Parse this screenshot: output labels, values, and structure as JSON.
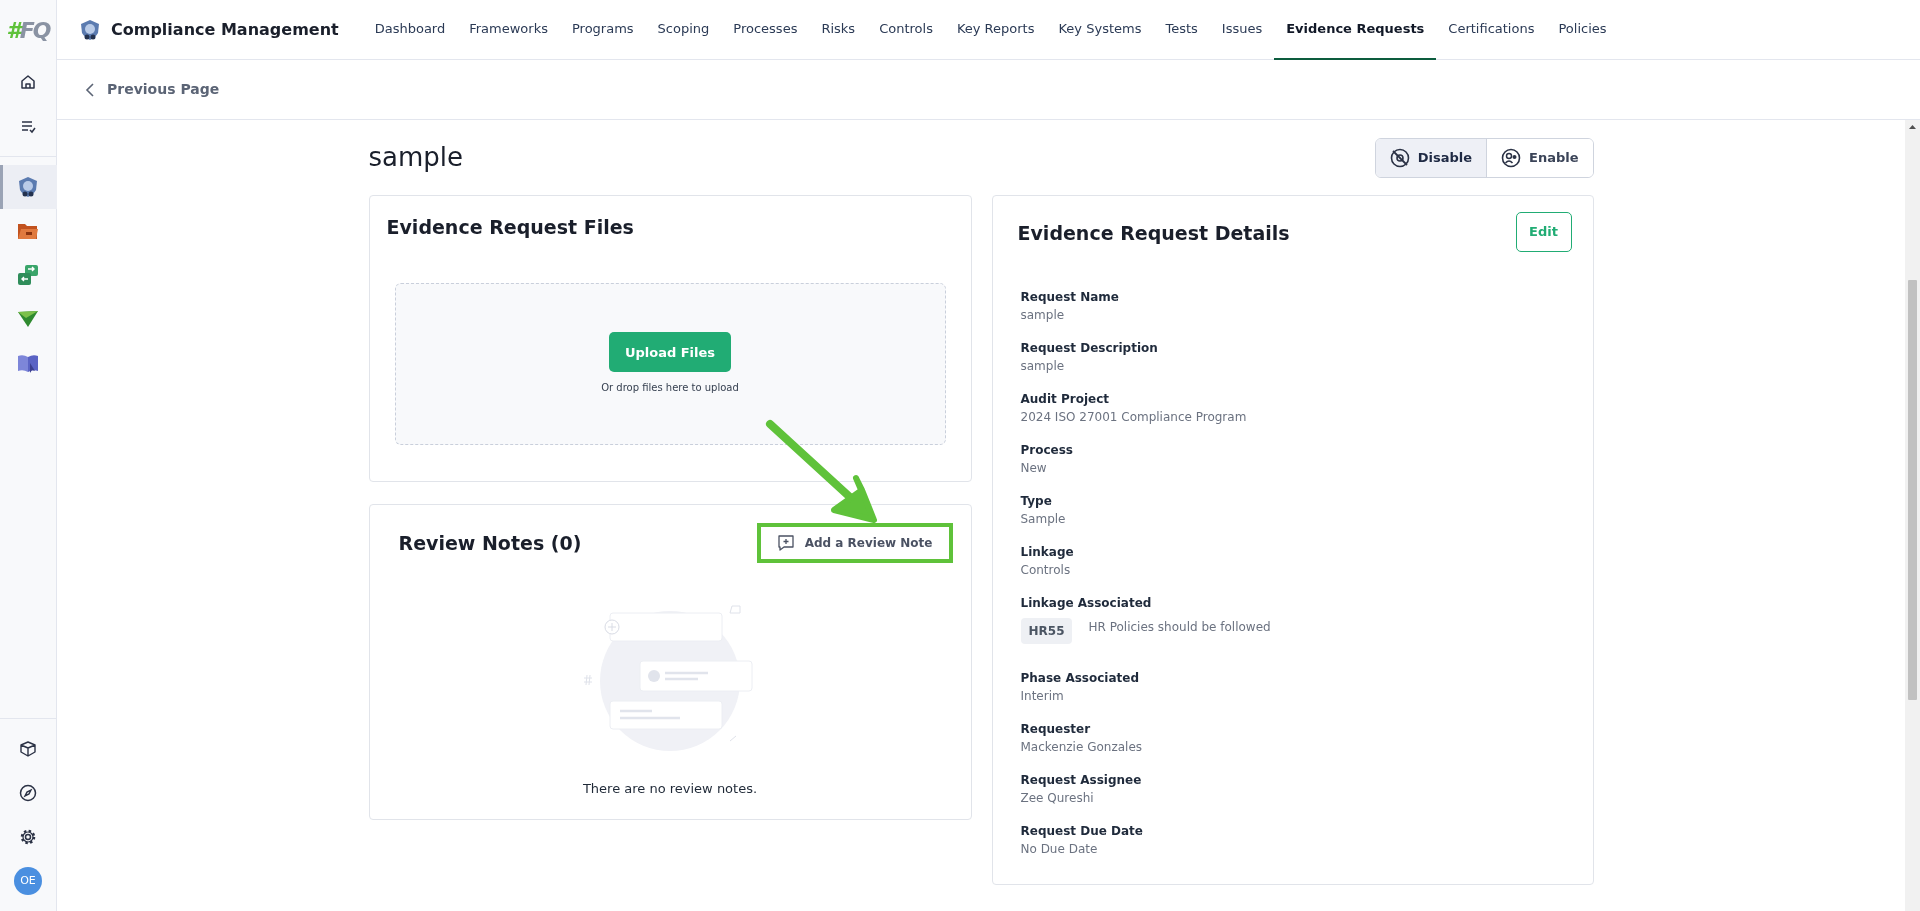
{
  "sidebar": {
    "logo": {
      "mark": "#",
      "text": "FQ"
    },
    "nav_items": [
      {
        "selected": false
      },
      {
        "selected": false
      },
      {
        "selected": true
      },
      {
        "selected": false
      },
      {
        "selected": false
      },
      {
        "selected": false
      },
      {
        "selected": false
      }
    ],
    "avatar": "OE"
  },
  "top_nav": {
    "title": "Compliance Management",
    "tabs": [
      {
        "label": "Dashboard",
        "selected": false
      },
      {
        "label": "Frameworks",
        "selected": false
      },
      {
        "label": "Programs",
        "selected": false
      },
      {
        "label": "Scoping",
        "selected": false
      },
      {
        "label": "Processes",
        "selected": false
      },
      {
        "label": "Risks",
        "selected": false
      },
      {
        "label": "Controls",
        "selected": false
      },
      {
        "label": "Key Reports",
        "selected": false
      },
      {
        "label": "Key Systems",
        "selected": false
      },
      {
        "label": "Tests",
        "selected": false
      },
      {
        "label": "Issues",
        "selected": false
      },
      {
        "label": "Evidence Requests",
        "selected": true
      },
      {
        "label": "Certifications",
        "selected": false
      },
      {
        "label": "Policies",
        "selected": false
      }
    ]
  },
  "back_link": "Previous Page",
  "page_title": "sample",
  "status_toggle": [
    {
      "label": "Disable",
      "selected": true
    },
    {
      "label": "Enable",
      "selected": false
    }
  ],
  "files_card": {
    "title": "Evidence Request Files",
    "upload_button": "Upload Files",
    "drop_hint": "Or drop files here to upload"
  },
  "review_notes": {
    "title": "Review Notes (0)",
    "add_button": "Add a Review Note",
    "highlighted": true,
    "empty_text": "There are no review notes."
  },
  "details_card": {
    "title": "Evidence Request Details",
    "edit_button": "Edit",
    "fields": [
      {
        "kind": "text",
        "label": "Request Name",
        "value": "sample"
      },
      {
        "kind": "text",
        "label": "Request Description",
        "value": "sample"
      },
      {
        "kind": "text",
        "label": "Audit Project",
        "value": "2024 ISO 27001 Compliance Program"
      },
      {
        "kind": "text",
        "label": "Process",
        "value": "New"
      },
      {
        "kind": "text",
        "label": "Type",
        "value": "Sample"
      },
      {
        "kind": "text",
        "label": "Linkage",
        "value": "Controls"
      },
      {
        "kind": "linkage",
        "label": "Linkage Associated",
        "code": "HR55",
        "value": "HR Policies should be followed"
      },
      {
        "kind": "text",
        "label": "Phase Associated",
        "value": "Interim"
      },
      {
        "kind": "text",
        "label": "Requester",
        "value": "Mackenzie Gonzales"
      },
      {
        "kind": "text",
        "label": "Request Assignee",
        "value": "Zee Qureshi"
      },
      {
        "kind": "text",
        "label": "Request Due Date",
        "value": "No Due Date"
      }
    ]
  }
}
